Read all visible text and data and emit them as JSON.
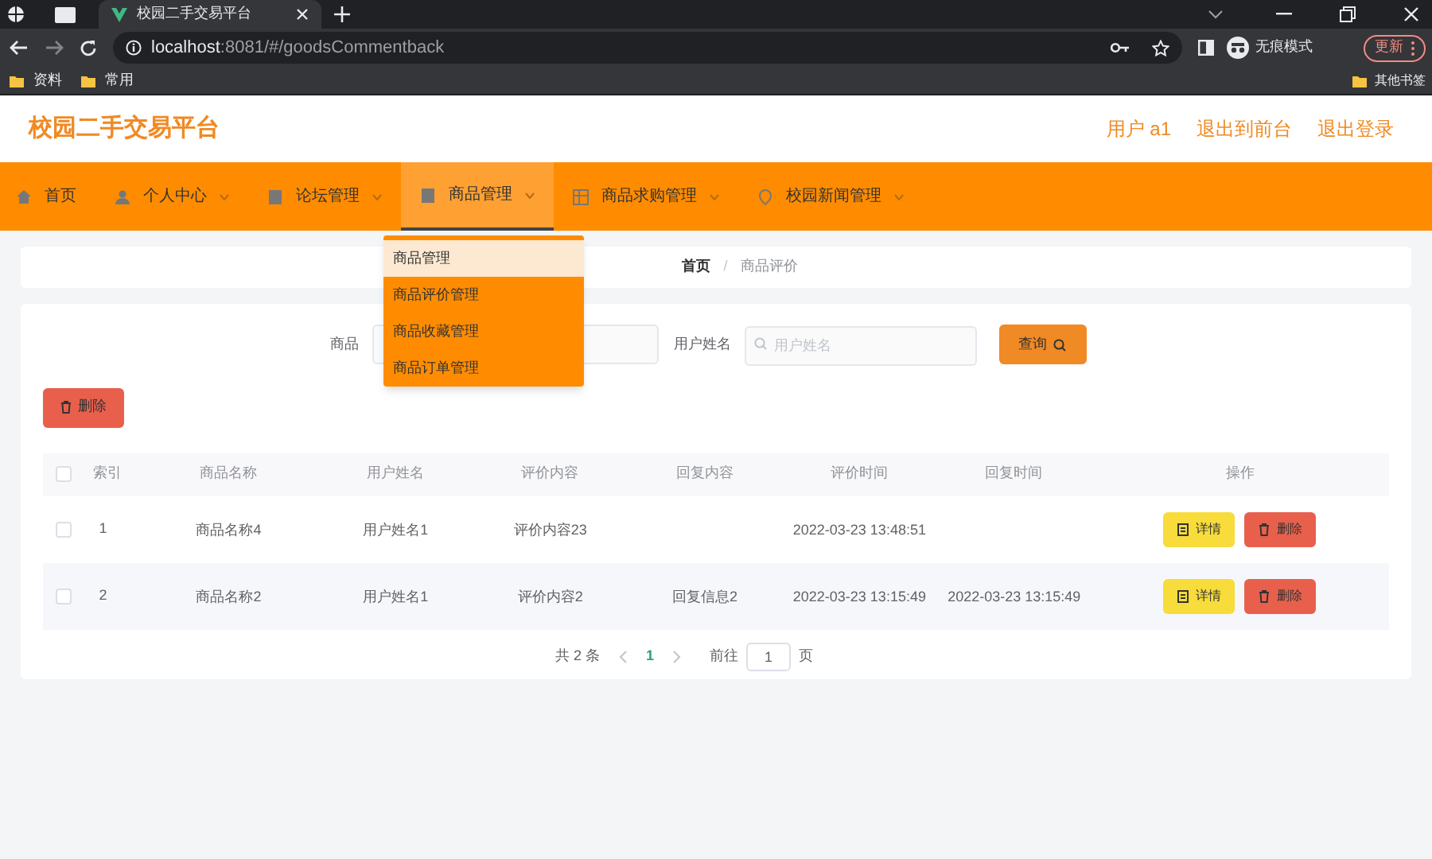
{
  "browser": {
    "tab_title": "校园二手交易平台",
    "url_host": "localhost",
    "url_rest": ":8081/#/goodsCommentback",
    "incognito_label": "无痕模式",
    "update_label": "更新",
    "bookmarks": [
      "资料",
      "常用"
    ],
    "other_bookmarks": "其他书签"
  },
  "header": {
    "title": "校园二手交易平台",
    "links": [
      "用户 a1",
      "退出到前台",
      "退出登录"
    ]
  },
  "nav": [
    {
      "label": "首页",
      "kind": "home",
      "selected": false
    },
    {
      "label": "个人中心",
      "kind": "person",
      "selected": false
    },
    {
      "label": "论坛管理",
      "kind": "doc",
      "selected": false
    },
    {
      "label": "商品管理",
      "kind": "doc",
      "selected": true
    },
    {
      "label": "商品求购管理",
      "kind": "grid",
      "selected": false
    },
    {
      "label": "校园新闻管理",
      "kind": "pin",
      "selected": false
    }
  ],
  "dropdown": [
    {
      "label": "商品管理",
      "selected": true
    },
    {
      "label": "商品评价管理",
      "selected": false
    },
    {
      "label": "商品收藏管理",
      "selected": false
    },
    {
      "label": "商品订单管理",
      "selected": false
    }
  ],
  "breadcrumb": {
    "items": [
      "首页",
      "商品评价"
    ],
    "separator": "/"
  },
  "search": {
    "label_1": "商品",
    "label_2": "用户姓名",
    "placeholder_2": "用户姓名",
    "button": "查询"
  },
  "delete_button": "删除",
  "table": {
    "select_all": {
      "checked": false
    },
    "columns": [
      "索引",
      "商品名称",
      "用户姓名",
      "评价内容",
      "回复内容",
      "评价时间",
      "回复时间",
      "操作"
    ],
    "rows": [
      {
        "cells": [
          "1",
          "商品名称4",
          "用户姓名1",
          "评价内容23",
          "",
          "2022-03-23 13:48:51",
          ""
        ],
        "checked": false,
        "actions": [
          "详情",
          "删除"
        ]
      },
      {
        "cells": [
          "2",
          "商品名称2",
          "用户姓名1",
          "评价内容2",
          "回复信息2",
          "2022-03-23 13:15:49",
          "2022-03-23 13:15:49"
        ],
        "checked": false,
        "actions": [
          "详情",
          "删除"
        ]
      }
    ]
  },
  "pagination": {
    "total": "共 2 条",
    "current": "1",
    "goto_label": "前往",
    "goto_value": "1",
    "page_suffix": "页"
  }
}
